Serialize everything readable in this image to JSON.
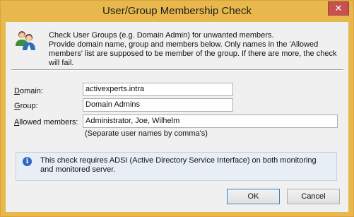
{
  "window": {
    "title": "User/Group Membership Check",
    "close_symbol": "✕",
    "accent_color": "#e9b84d"
  },
  "header": {
    "icon": "users-group-icon",
    "description": "Check User Groups (e.g.  Domain Admin)  for unwanted members.\nProvide domain name, group and members below. Only names in the 'Allowed members' list are supposed to be member of the group. If there are more, the check will fail."
  },
  "form": {
    "domain_label_accel": "D",
    "domain_label_rest": "omain:",
    "domain_value": "activexperts.intra",
    "group_label_accel": "G",
    "group_label_rest": "roup:",
    "group_value": "Domain Admins",
    "allowed_label_accel": "A",
    "allowed_label_rest": "llowed members:",
    "allowed_value": "Administrator, Joe, Wilhelm",
    "allowed_hint": "(Separate user names by comma's)"
  },
  "info": {
    "icon": "info-icon",
    "text": "This check requires ADSI (Active Directory Service Interface) on both monitoring and monitored server."
  },
  "buttons": {
    "ok_label": "OK",
    "cancel_label": "Cancel"
  }
}
